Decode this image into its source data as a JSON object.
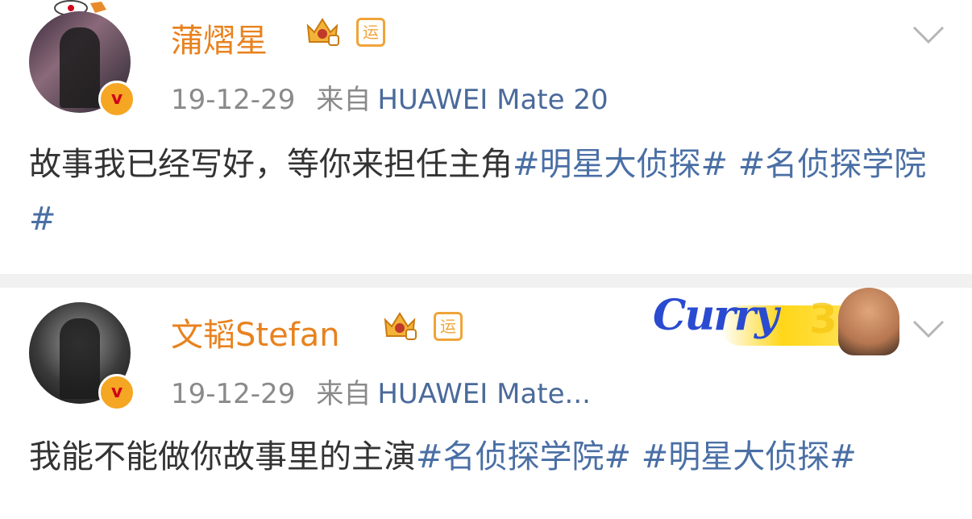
{
  "posts": [
    {
      "username": "蒲熠星",
      "vip_badge_text": "v",
      "yun_label": "运",
      "date": "19-12-29",
      "from_label": "来自",
      "device": "HUAWEI Mate 20",
      "text": "故事我已经写好，等你来担任主角",
      "tags": [
        "#明星大侦探#",
        "#名侦探学院#"
      ]
    },
    {
      "username": "文韬Stefan",
      "vip_badge_text": "v",
      "yun_label": "运",
      "date": "19-12-29",
      "from_label": "来自",
      "device": "HUAWEI Mate...",
      "text": "我能不能做你故事里的主演",
      "tags": [
        "#名侦探学院#",
        "#明星大侦探#"
      ]
    }
  ],
  "sticker": {
    "word": "Curry",
    "number": "30"
  },
  "colors": {
    "username": "#e8821f",
    "hashtag": "#4a6fa5",
    "meta": "#8a8a8a",
    "badge": "#f5a623"
  },
  "icons": [
    "chevron-down-icon",
    "crown-icon",
    "verified-badge-icon"
  ]
}
